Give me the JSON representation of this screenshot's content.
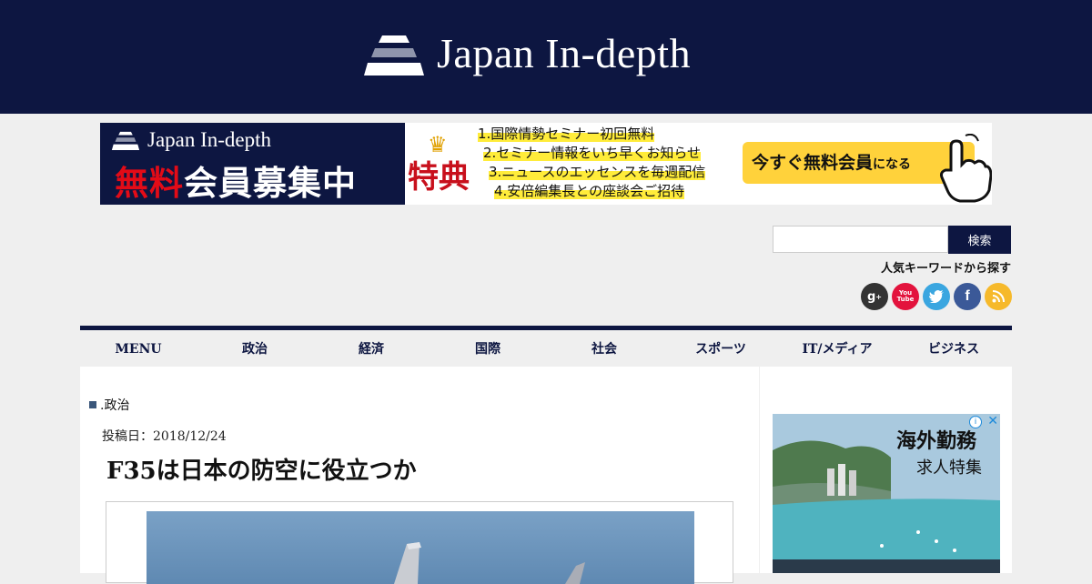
{
  "site": {
    "name": "Japan In-depth"
  },
  "banner": {
    "brand": "Japan In-depth",
    "recruit_a": "無料",
    "recruit_b": "会員",
    "recruit_c": "募集中",
    "tokuten": "特典",
    "benefits": [
      "1.国際情勢セミナー初回無料",
      "2.セミナー情報をいち早くお知らせ",
      "3.ニュースのエッセンスを毎週配信",
      "4.安倍編集長との座談会ご招待"
    ],
    "cta_a": "今すぐ無料会員",
    "cta_b": "になる"
  },
  "search": {
    "button_label": "検索",
    "placeholder": ""
  },
  "keywords_label": "人気キーワードから探す",
  "social": [
    {
      "name": "google-plus-icon",
      "glyph": "g+",
      "color": "#333333"
    },
    {
      "name": "youtube-icon",
      "glyph": "You\nTube",
      "color": "#e3133d"
    },
    {
      "name": "twitter-icon",
      "glyph": "🐦",
      "color": "#3aa6e0"
    },
    {
      "name": "facebook-icon",
      "glyph": "f",
      "color": "#3b5998"
    },
    {
      "name": "rss-icon",
      "glyph": "◉",
      "color": "#f6b92b"
    }
  ],
  "nav": [
    "MENU",
    "政治",
    "経済",
    "国際",
    "社会",
    "スポーツ",
    "IT/メディア",
    "ビジネス"
  ],
  "article": {
    "category": ".政治",
    "date": "投稿日：2018/12/24",
    "title": "F35は日本の防空に役立つか"
  },
  "ad": {
    "headline": "海外勤務",
    "sub": "求人特集",
    "info_icon": "i",
    "close_icon": "✕"
  }
}
